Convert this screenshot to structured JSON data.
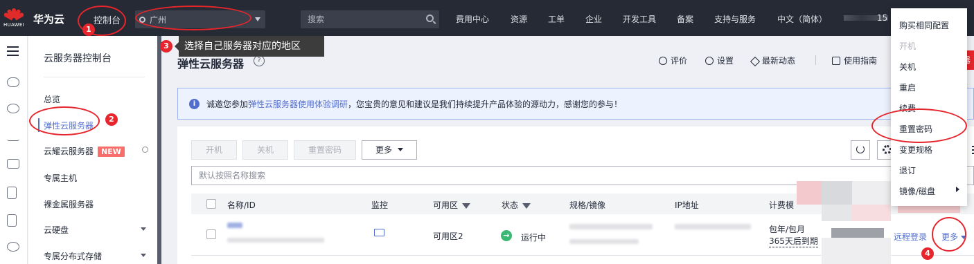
{
  "topbar": {
    "logo_text": "HUAWEI",
    "brand": "华为云",
    "console": "控制台",
    "region": "广州",
    "search_placeholder": "搜索",
    "nav": [
      "费用中心",
      "资源",
      "工单",
      "企业",
      "开发工具",
      "备案",
      "支持与服务",
      "中文（简体）"
    ],
    "account_suffix": "15"
  },
  "sidemenu": {
    "title": "云服务器控制台",
    "items": [
      "总览",
      "弹性云服务器",
      "云耀云服务器",
      "专属主机",
      "裸金属服务器",
      "云硬盘",
      "专属分布式存储"
    ],
    "new_badge": "NEW"
  },
  "tooltip": "选择自己服务器对应的地区",
  "page": {
    "title": "弹性云服务器",
    "help": "?",
    "tools": [
      "评价",
      "设置",
      "最新动态",
      "使用指南"
    ],
    "red_tab": "器"
  },
  "notice": {
    "prefix": "诚邀您参加",
    "link": "弹性云服务器使用体验调研",
    "suffix": "，您宝贵的意见和建议是我们持续提升产品体验的源动力，感谢您的参与！"
  },
  "toolbar": {
    "buttons": [
      "开机",
      "关机",
      "重置密码"
    ],
    "more": "更多"
  },
  "filter_placeholder": "默认按照名称搜索",
  "table": {
    "columns": [
      "名称/ID",
      "监控",
      "可用区",
      "状态",
      "规格/镜像",
      "IP地址",
      "计费模"
    ],
    "row": {
      "az": "可用区2",
      "status": "运行中",
      "billing": "包年/包月",
      "expiry": "365天后到期",
      "remote": "远程登录",
      "more": "更多"
    }
  },
  "dropdown": {
    "items": [
      "购买相同配置",
      "开机",
      "关机",
      "重启",
      "续费",
      "重置密码",
      "变更规格",
      "退订",
      "镜像/磁盘"
    ]
  },
  "annotations": [
    "1",
    "2",
    "3",
    "4"
  ],
  "colors": {
    "accent": "#526ecc",
    "annotation": "#e6252c",
    "topbar": "#252a35",
    "running": "#3bb873"
  }
}
